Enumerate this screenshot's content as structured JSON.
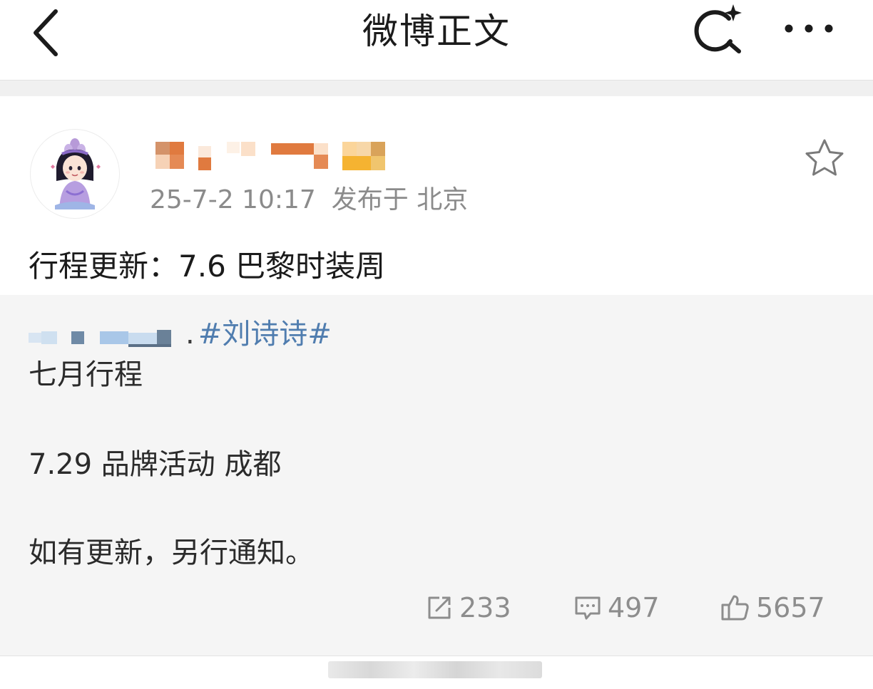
{
  "nav": {
    "title": "微博正文"
  },
  "icons": {
    "back": "chevron-left-icon",
    "search": "search-sparkle-icon",
    "more": "more-dots-icon",
    "favorite": "star-outline-icon",
    "repost": "share-box-icon",
    "comment": "comment-bubble-icon",
    "like": "thumbs-up-icon"
  },
  "post": {
    "timestamp": "25-7-2 10:17",
    "location": "发布于 北京",
    "text": "行程更新：7.6 巴黎时装周"
  },
  "repost": {
    "source_separator": ".",
    "hashtag": "#刘诗诗#",
    "lines": [
      "七月行程",
      "7.29 品牌活动 成都",
      "如有更新，另行通知。"
    ]
  },
  "actions": {
    "repost_count": "233",
    "comment_count": "497",
    "like_count": "5657"
  },
  "colors": {
    "hashtag": "#507daf",
    "meta_text": "#8b8b8b",
    "repost_background": "#f5f5f5"
  }
}
